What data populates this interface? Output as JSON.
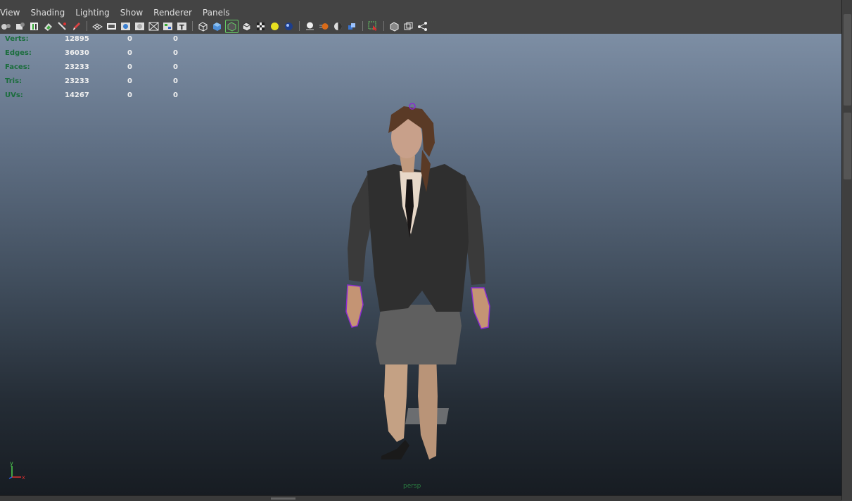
{
  "menu": {
    "items": [
      "View",
      "Shading",
      "Lighting",
      "Show",
      "Renderer",
      "Panels"
    ]
  },
  "toolbar": {
    "icons": [
      "camera-select-icon",
      "camera-attributes-icon",
      "bookmarks-icon",
      "image-plane-icon",
      "two-d-pan-zoom-icon",
      "grease-pencil-icon",
      "grid-icon",
      "film-gate-icon",
      "resolution-gate-icon",
      "gate-mask-icon",
      "field-chart-icon",
      "safe-action-icon",
      "safe-title-icon",
      "wireframe-icon",
      "smooth-shade-icon",
      "wireframe-on-shaded-icon",
      "default-material-icon",
      "texture-checker-icon",
      "use-all-lights-icon",
      "shadows-icon",
      "screen-space-ao-icon",
      "motion-blur-icon",
      "multisample-aa-icon",
      "depth-of-field-icon",
      "isolate-select-icon",
      "xray-icon",
      "xray-active-components-icon",
      "xray-joints-icon"
    ]
  },
  "hud": {
    "rows": [
      {
        "label": "Verts:",
        "v1": "12895",
        "v2": "0",
        "v3": "0"
      },
      {
        "label": "Edges:",
        "v1": "36030",
        "v2": "0",
        "v3": "0"
      },
      {
        "label": "Faces:",
        "v1": "23233",
        "v2": "0",
        "v3": "0"
      },
      {
        "label": "Tris:",
        "v1": "23233",
        "v2": "0",
        "v3": "0"
      },
      {
        "label": "UVs:",
        "v1": "14267",
        "v2": "0",
        "v3": "0"
      }
    ]
  },
  "viewport": {
    "camera": "persp",
    "axis_y": "y",
    "axis_x": "x"
  },
  "colors": {
    "hud_label": "#1b6d3d",
    "hud_value": "#f0f0f0",
    "axis_y": "#4fd24f",
    "axis_x": "#e03030"
  }
}
